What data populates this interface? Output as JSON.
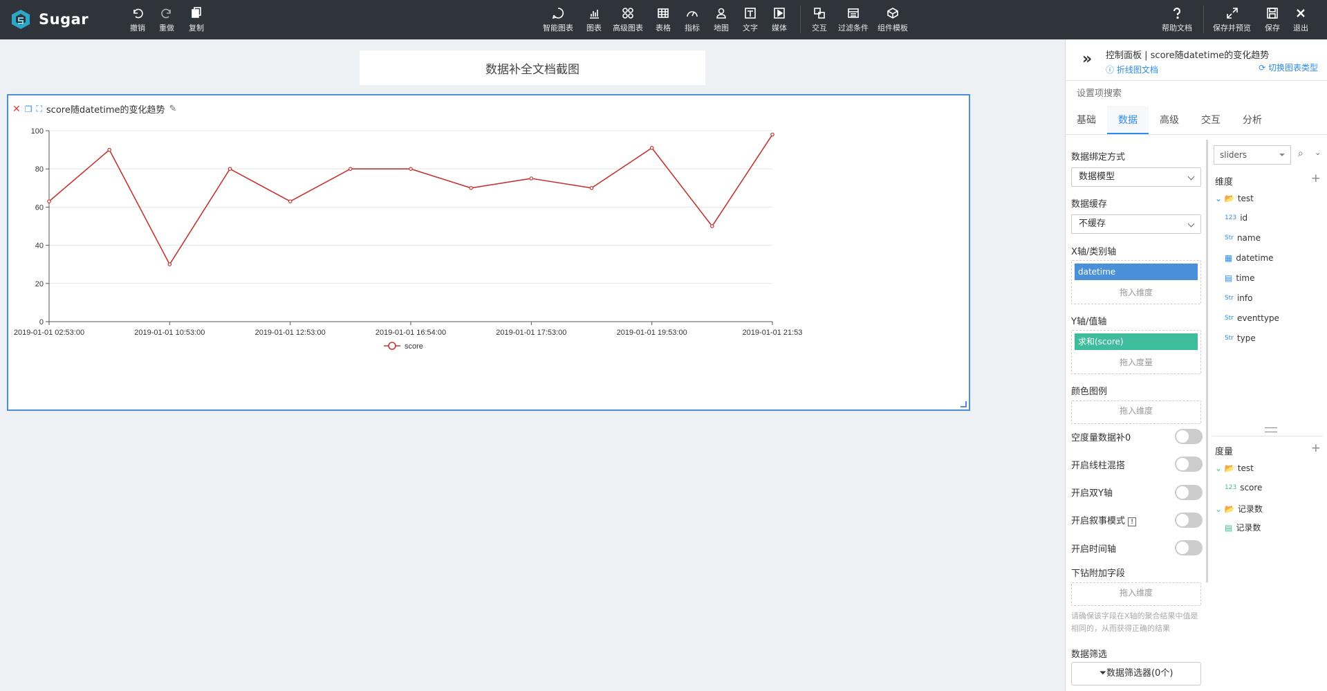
{
  "app": {
    "name": "Sugar"
  },
  "toolbar": {
    "left": [
      {
        "label": "撤销",
        "icon": "undo-icon"
      },
      {
        "label": "重做",
        "icon": "redo-icon"
      },
      {
        "label": "复制",
        "icon": "copy-icon"
      }
    ],
    "center": [
      {
        "label": "智能图表",
        "icon": "smart-chart-icon"
      },
      {
        "label": "图表",
        "icon": "bar-chart-icon"
      },
      {
        "label": "高级图表",
        "icon": "advanced-chart-icon"
      },
      {
        "label": "表格",
        "icon": "table-icon"
      },
      {
        "label": "指标",
        "icon": "gauge-icon"
      },
      {
        "label": "地图",
        "icon": "map-pin-icon"
      },
      {
        "label": "文字",
        "icon": "text-icon"
      },
      {
        "label": "媒体",
        "icon": "media-icon"
      },
      {
        "label": "交互",
        "icon": "interaction-icon"
      },
      {
        "label": "过滤条件",
        "icon": "filter-icon"
      },
      {
        "label": "组件模板",
        "icon": "template-icon"
      }
    ],
    "right": [
      {
        "label": "帮助文档",
        "icon": "help-icon"
      },
      {
        "label": "保存并预览",
        "icon": "expand-icon"
      },
      {
        "label": "保存",
        "icon": "save-icon"
      },
      {
        "label": "退出",
        "icon": "close-icon"
      }
    ]
  },
  "canvas": {
    "title": "数据补全文档截图",
    "chart_title": "score随datetime的变化趋势"
  },
  "chart_data": {
    "type": "line",
    "title": "score随datetime的变化趋势",
    "x_tick_labels": [
      "2019-01-01 02:53:00",
      "2019-01-01 10:53:00",
      "2019-01-01 12:53:00",
      "2019-01-01 16:54:00",
      "2019-01-01 17:53:00",
      "2019-01-01 19:53:00",
      "2019-01-01 21:53"
    ],
    "y_ticks": [
      0,
      20,
      40,
      60,
      80,
      100
    ],
    "ylim": [
      0,
      100
    ],
    "series": [
      {
        "name": "score",
        "values": [
          63,
          90,
          30,
          80,
          63,
          80,
          80,
          70,
          75,
          70,
          91,
          50,
          98
        ]
      }
    ],
    "legend": "bottom-center",
    "grid": true,
    "color": "#c23531"
  },
  "panel": {
    "header_title": "控制面板 | score随datetime的变化趋势",
    "doc_link": "折线图文档",
    "switch_link": "切换图表类型",
    "search_placeholder": "设置项搜索",
    "tabs": [
      "基础",
      "数据",
      "高级",
      "交互",
      "分析"
    ],
    "active_tab": "数据",
    "binding_label": "数据绑定方式",
    "binding_value": "数据模型",
    "cache_label": "数据缓存",
    "cache_value": "不缓存",
    "x_axis_label": "X轴/类别轴",
    "x_axis_field": "datetime",
    "drop_dimension": "拖入维度",
    "y_axis_label": "Y轴/值轴",
    "y_axis_field": "求和(score)",
    "drop_measure": "拖入度量",
    "color_legend_label": "颜色图例",
    "toggles": [
      {
        "label": "空度量数据补0",
        "on": false
      },
      {
        "label": "开启线柱混搭",
        "on": false
      },
      {
        "label": "开启双Y轴",
        "on": false
      },
      {
        "label": "开启叙事模式",
        "on": false
      },
      {
        "label": "开启时间轴",
        "on": false
      }
    ],
    "drill_label": "下钻附加字段",
    "drill_hint": "请确保该字段在X轴的聚合结果中值是相同的，从而获得正确的结果",
    "filter_label": "数据筛选",
    "filter_button": "数据筛选器(0个)",
    "source_select": "sliders",
    "dimension_label": "维度",
    "dimension_folder": "test",
    "dimension_fields": [
      {
        "tag": "123",
        "name": "id"
      },
      {
        "tag": "Str",
        "name": "name"
      },
      {
        "tag": "date",
        "name": "datetime"
      },
      {
        "tag": "date",
        "name": "time"
      },
      {
        "tag": "Str",
        "name": "info"
      },
      {
        "tag": "Str",
        "name": "eventtype"
      },
      {
        "tag": "Str",
        "name": "type"
      }
    ],
    "measure_label": "度量",
    "measure_folder": "test",
    "measure_fields": [
      {
        "tag": "123",
        "name": "score"
      }
    ],
    "count_folder": "记录数",
    "count_field": "记录数"
  }
}
